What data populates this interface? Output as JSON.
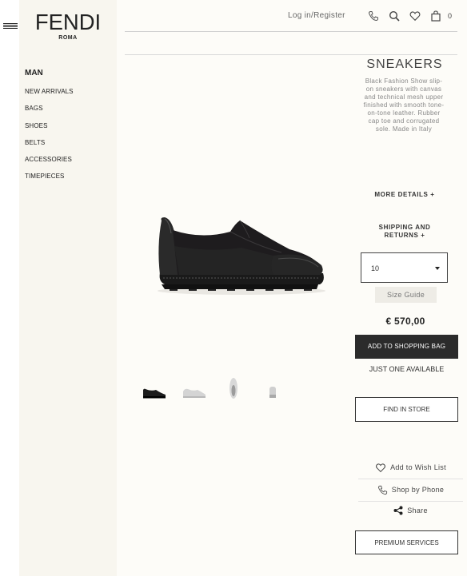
{
  "brand": {
    "name": "FENDI",
    "sub": "ROMA"
  },
  "sidebar": {
    "title": "MAN",
    "items": [
      "NEW ARRIVALS",
      "BAGS",
      "SHOES",
      "BELTS",
      "ACCESSORIES",
      "TIMEPIECES"
    ]
  },
  "header": {
    "login": "Log in/Register",
    "bag_count": "0"
  },
  "product": {
    "title": "SNEAKERS",
    "description": "Black Fashion Show slip-on sneakers with canvas and technical mesh upper finished with smooth tone-on-tone leather. Rubber cap toe and corrugated sole. Made in Italy",
    "more_details": "MORE DETAILS  +",
    "shipping_line1": "SHIPPING AND",
    "shipping_line2": "RETURNS  +",
    "size_value": "10",
    "size_guide": "Size Guide",
    "price": "€ 570,00",
    "add_to_bag": "ADD TO SHOPPING BAG",
    "availability": "JUST ONE AVAILABLE",
    "find_in_store": "FIND IN STORE",
    "wish_list": "Add to Wish List",
    "shop_by_phone": "Shop by Phone",
    "share": "Share",
    "premium": "PREMIUM SERVICES"
  },
  "icons": [
    "hamburger-icon",
    "phone-icon",
    "search-icon",
    "heart-icon",
    "bag-icon",
    "share-icon"
  ],
  "colors": {
    "background": "#fdfcf8",
    "sidebar": "#f8f6ef",
    "button_dark": "#2b2b2b",
    "text": "#333333"
  }
}
